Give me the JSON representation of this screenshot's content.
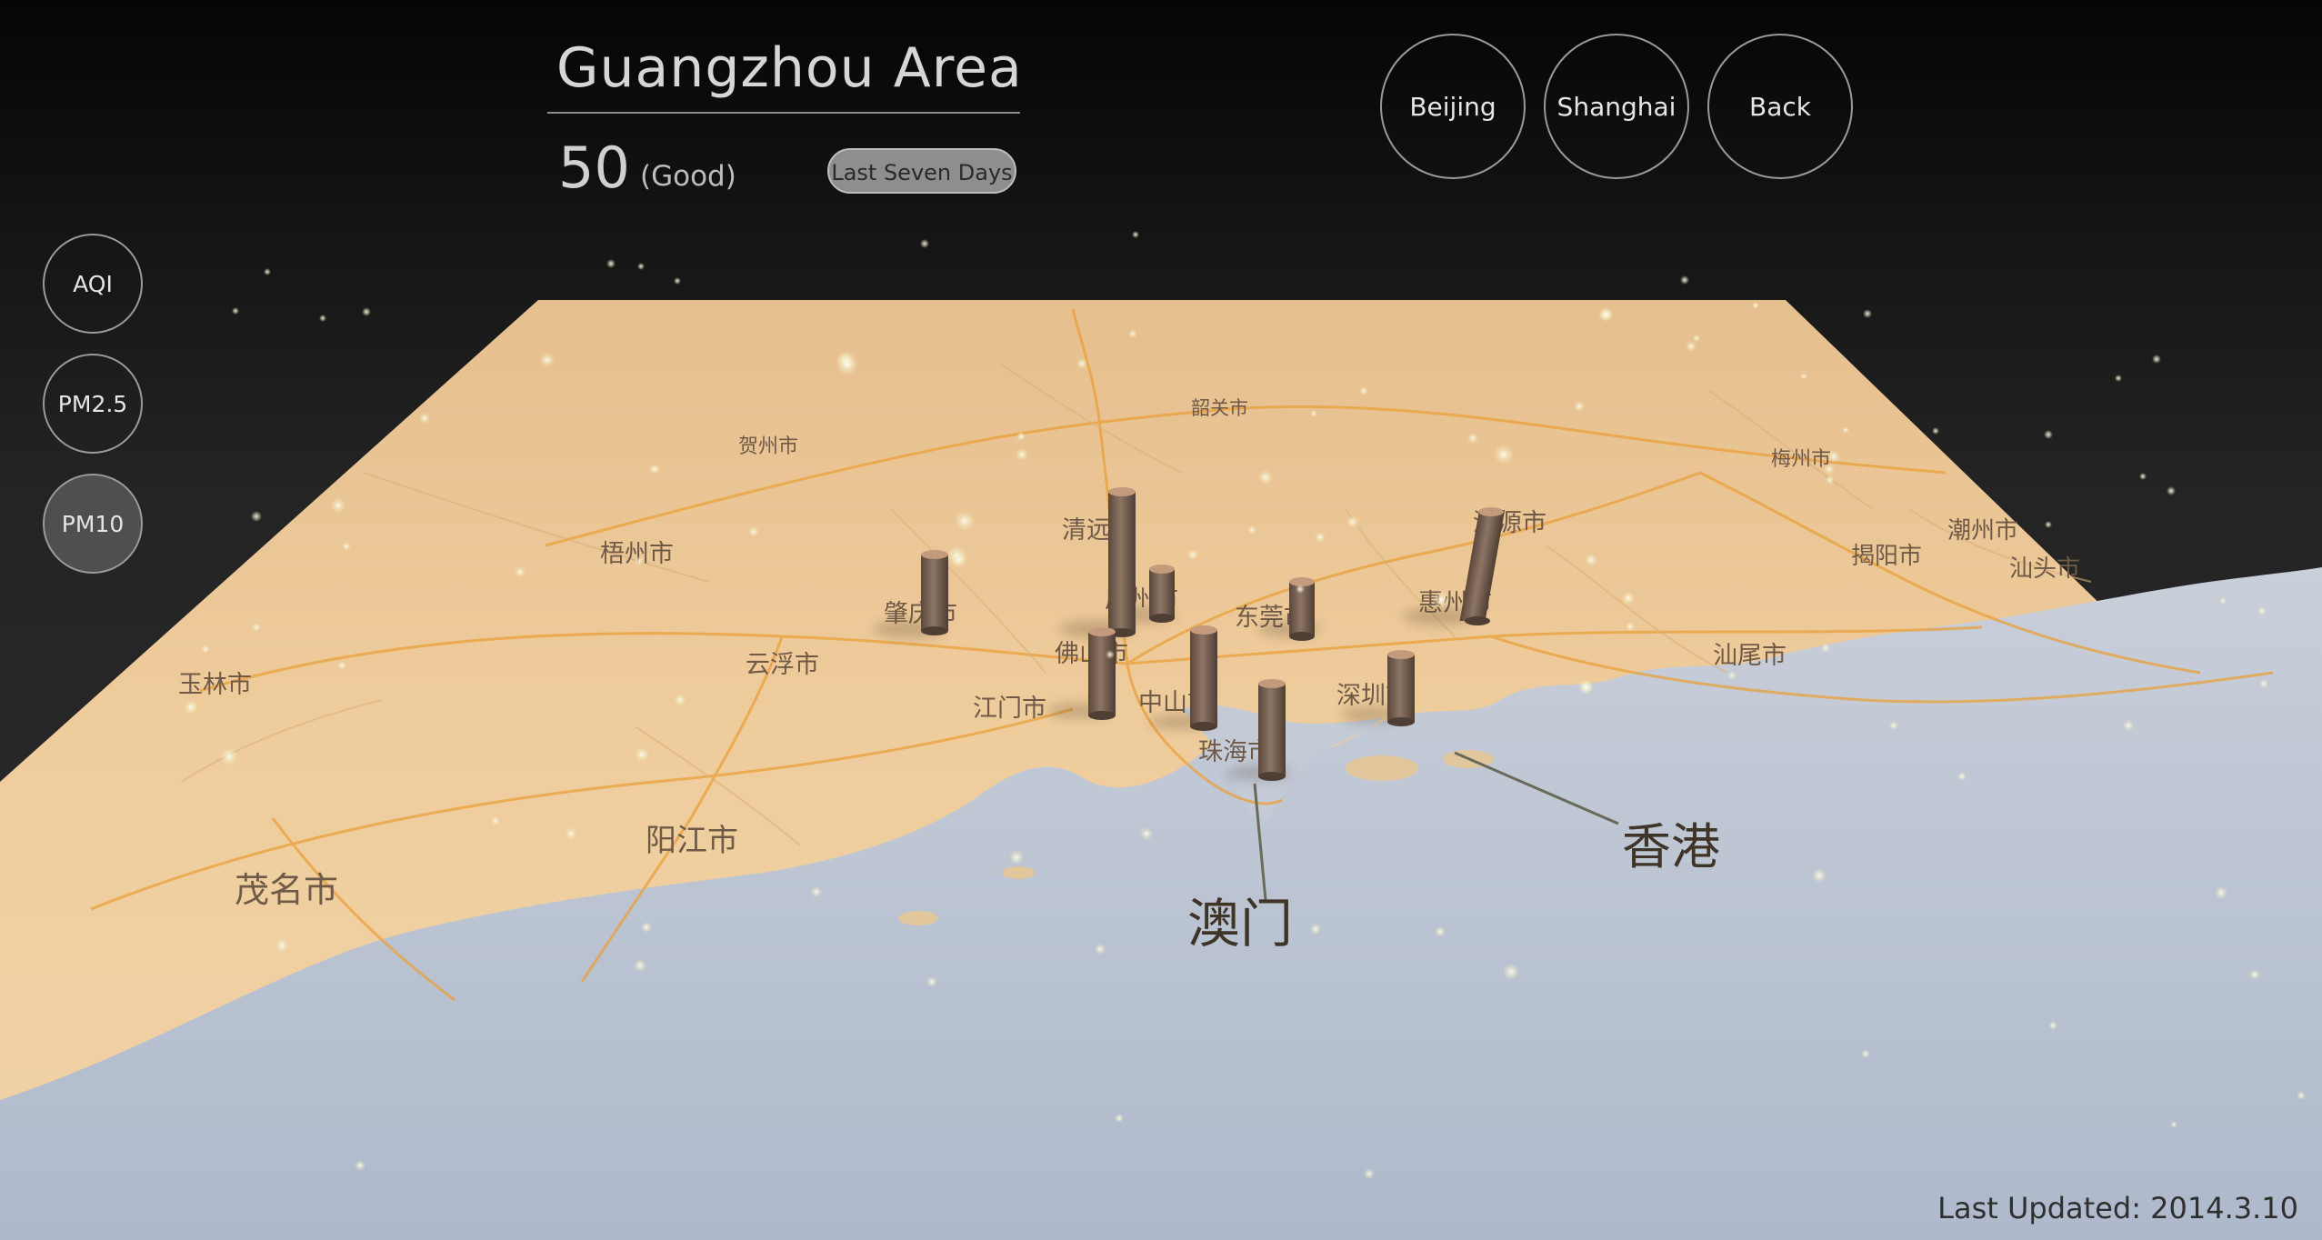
{
  "header": {
    "title": "Guangzhou Area",
    "aqi_value": "50",
    "aqi_label": "(Good)",
    "range_button": "Last Seven Days"
  },
  "city_buttons": [
    "Beijing",
    "Shanghai",
    "Back"
  ],
  "metric_buttons": [
    "AQI",
    "PM2.5",
    "PM10"
  ],
  "active_metric": "PM10",
  "footer": {
    "last_updated": "Last Updated: 2014.3.10"
  },
  "map": {
    "city_labels": [
      "清远市",
      "广州市",
      "东莞市",
      "惠州市",
      "河源市",
      "佛山市",
      "江门市",
      "中山市",
      "珠海市",
      "深圳市",
      "肇庆市",
      "云浮市",
      "阳江市",
      "茂名市",
      "玉林市",
      "梧州市",
      "贺州市",
      "韶关市",
      "梅州市",
      "潮州市",
      "揭阳市",
      "汕头市",
      "汕尾市"
    ],
    "callouts": [
      "澳门",
      "香港"
    ]
  },
  "colors": {
    "land": "#e9c697",
    "sea": "#bcc6d8",
    "roads": "#e9a03a",
    "pillar": "#7b6454",
    "particle": "#f4f0c8"
  }
}
